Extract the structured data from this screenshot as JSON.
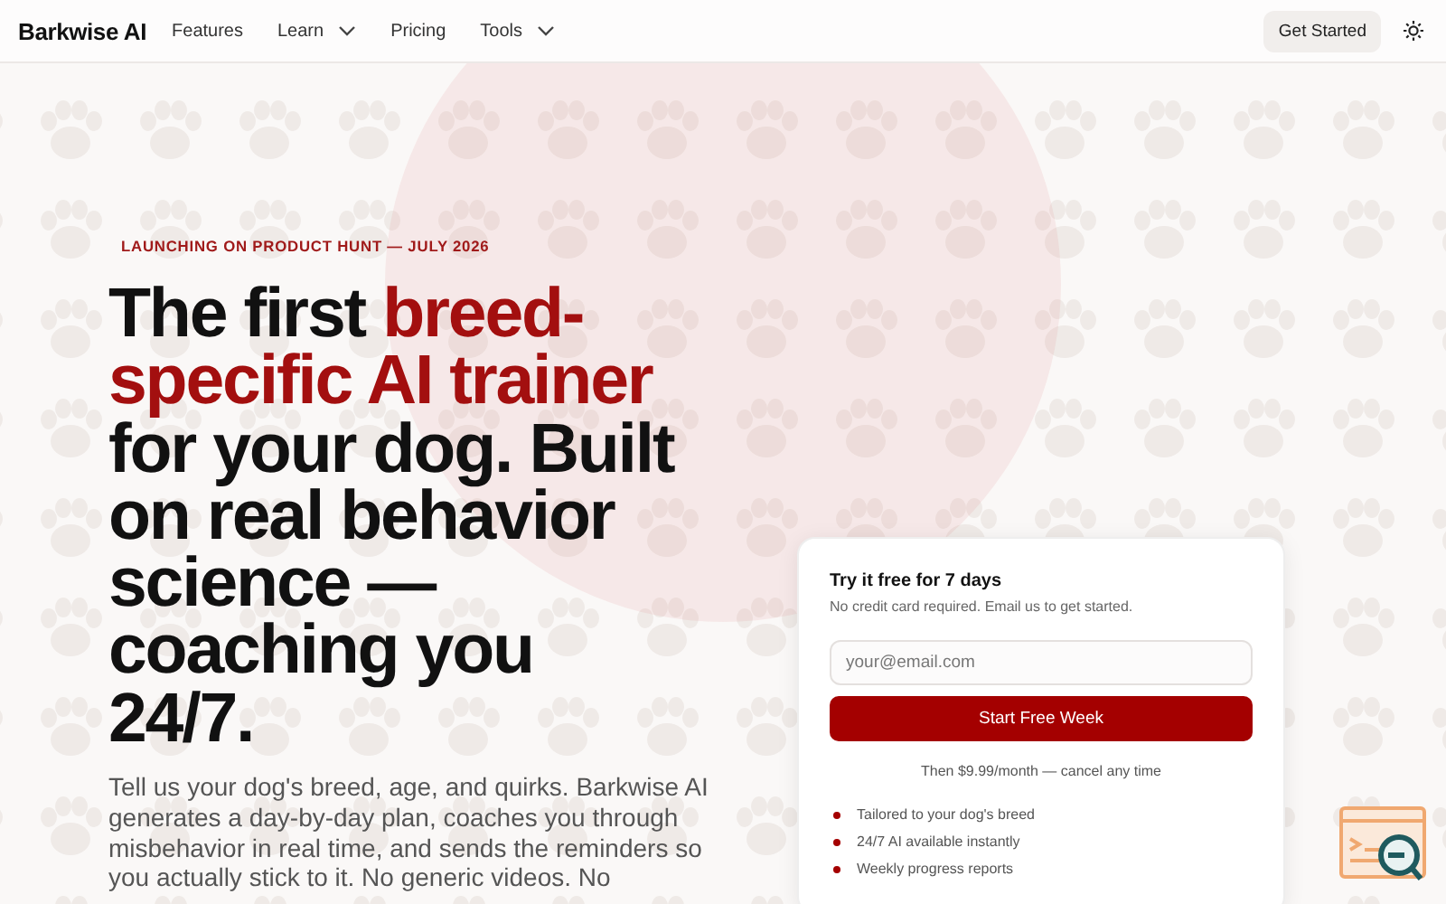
{
  "nav": {
    "brand": "Barkwise AI",
    "links": [
      {
        "label": "Features",
        "dropdown": false
      },
      {
        "label": "Learn",
        "dropdown": true
      },
      {
        "label": "Pricing",
        "dropdown": false
      },
      {
        "label": "Tools",
        "dropdown": true
      }
    ],
    "cta": "Get Started"
  },
  "hero": {
    "eyebrow": "LAUNCHING ON PRODUCT HUNT — JULY 2026",
    "headline": [
      {
        "text": "The first ",
        "accent": false
      },
      {
        "text": "breed-specific AI trainer",
        "accent": true
      },
      {
        "text": " for your dog. Built on real behavior science — coaching you 24/7.",
        "accent": false
      }
    ],
    "body": "Tell us your dog's breed, age, and quirks. Barkwise AI generates a day-by-day plan, coaches you through misbehavior in real time, and sends the reminders so you actually stick to it. No generic videos. No"
  },
  "signup": {
    "title": "Try it free for 7 days",
    "subtitle": "No credit card required. Email us to get started.",
    "email": {
      "placeholder": "your@email.com"
    },
    "button": "Start Free Week",
    "note": "Then $9.99/month — cancel any time",
    "features": [
      "Tailored to your dog's breed",
      "24/7 AI available instantly",
      "Weekly progress reports"
    ]
  }
}
